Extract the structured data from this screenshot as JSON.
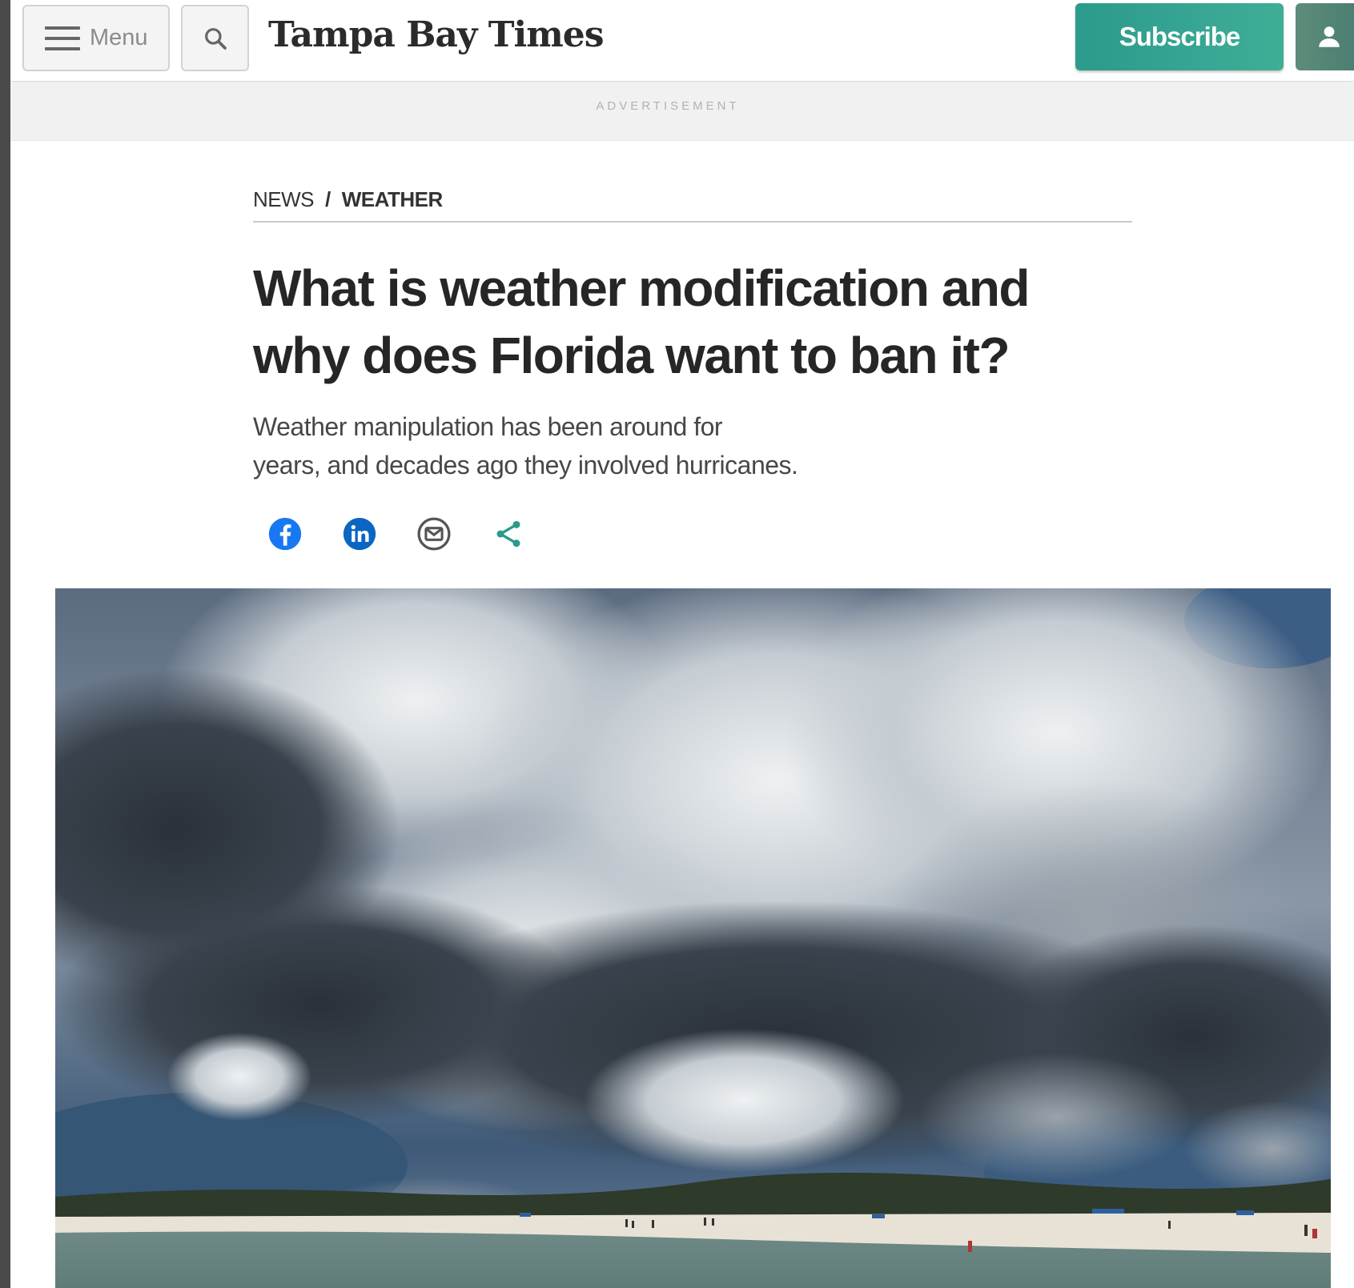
{
  "header": {
    "menu_label": "Menu",
    "logo_text": "Tampa Bay Times",
    "subscribe_label": "Subscribe"
  },
  "ad": {
    "label": "ADVERTISEMENT"
  },
  "breadcrumb": {
    "section": "NEWS",
    "separator": "/",
    "subsection": "WEATHER"
  },
  "article": {
    "headline_line1": "What is weather modification and",
    "headline_line2": "why does Florida want to ban it?",
    "dek_line1": "Weather manipulation has been around for",
    "dek_line2": "years, and decades ago they involved hurricanes."
  },
  "share": {
    "icons": [
      "facebook-icon",
      "linkedin-icon",
      "email-icon",
      "share-icon"
    ],
    "colors": {
      "facebook": "#1877f2",
      "linkedin": "#0a66c2",
      "email": "#555555",
      "share": "#2c9a8c"
    }
  },
  "brand": {
    "accent": "#2c9a8c"
  }
}
